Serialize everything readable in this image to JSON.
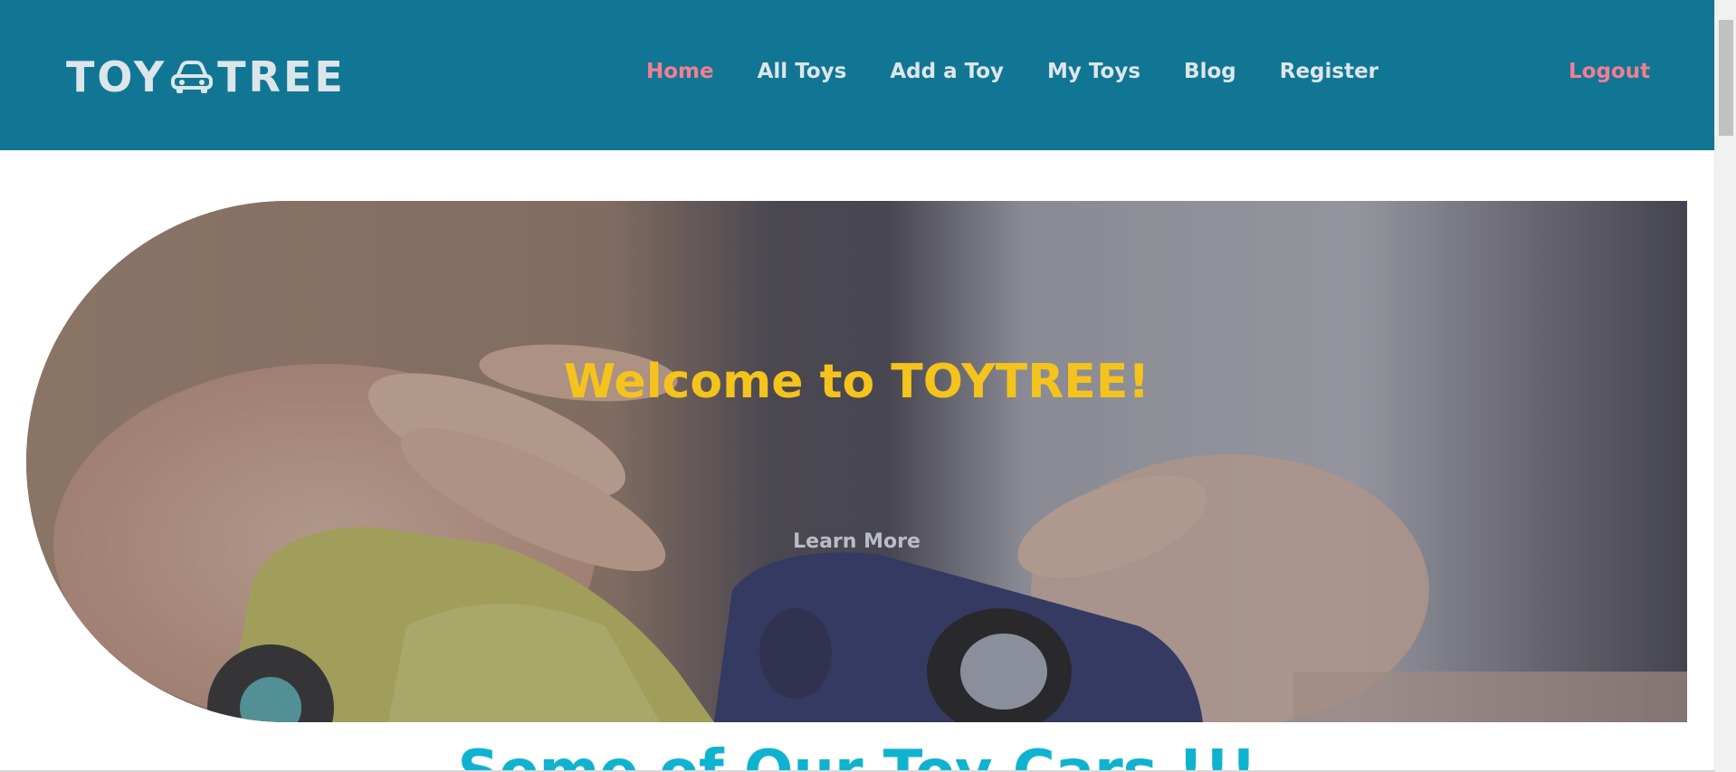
{
  "logo": {
    "left": "TOY",
    "right": "TREE",
    "icon": "car-icon"
  },
  "nav": {
    "items": [
      {
        "label": "Home",
        "active": true
      },
      {
        "label": "All Toys"
      },
      {
        "label": "Add a Toy"
      },
      {
        "label": "My Toys"
      },
      {
        "label": "Blog"
      },
      {
        "label": "Register"
      }
    ],
    "logout": "Logout"
  },
  "hero": {
    "title": "Welcome to TOYTREE!",
    "button": "Learn More"
  },
  "section": {
    "heading": "Some of Our Toy Cars !!!"
  },
  "colors": {
    "navbar": "#117694",
    "accent": "#f17f92",
    "title": "#f5c41c",
    "heading": "#10b3cf"
  }
}
